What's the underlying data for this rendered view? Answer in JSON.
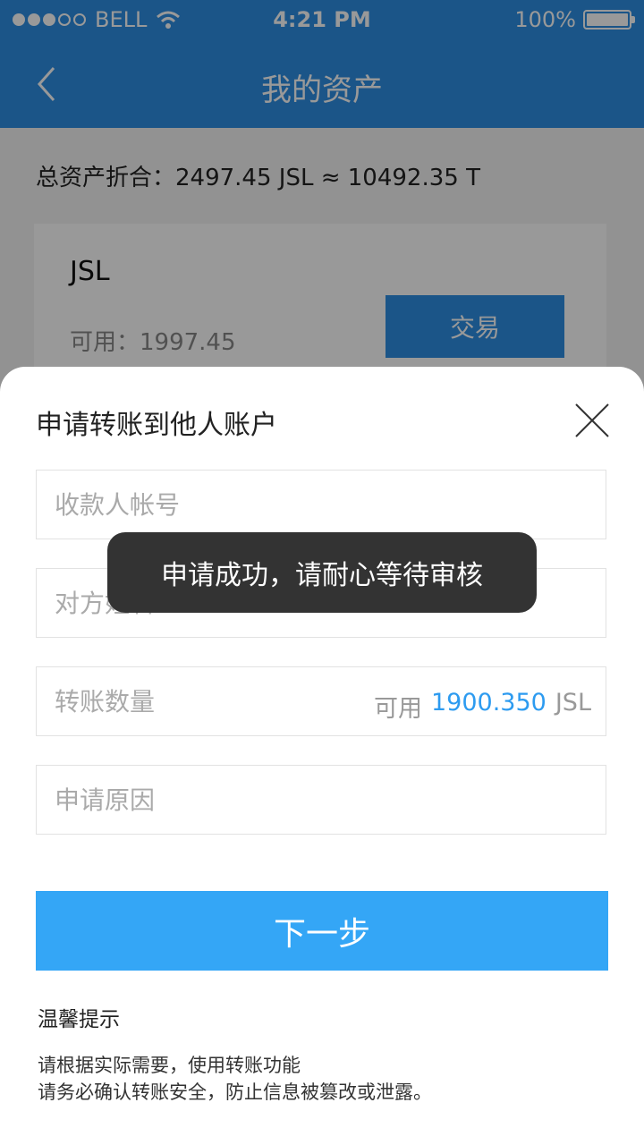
{
  "status_bar": {
    "carrier": "BELL",
    "time": "4:21 PM",
    "battery": "100%"
  },
  "nav": {
    "title": "我的资产",
    "back_icon": "chevron-left-icon"
  },
  "summary": {
    "total_text": "总资产折合：2497.45 JSL ≈ 10492.35 T"
  },
  "asset_card": {
    "coin": "JSL",
    "available": "可用：1997.45",
    "trade_label": "交易"
  },
  "transfer_sheet": {
    "title": "申请转账到他人账户",
    "close_icon": "close-icon",
    "fields": {
      "account_placeholder": "收款人帐号",
      "name_placeholder": "对方姓名",
      "amount_placeholder": "转账数量",
      "amount_available_label": "可用",
      "amount_available_value": "1900.350",
      "amount_unit": "JSL",
      "reason_placeholder": "申请原因"
    },
    "next_label": "下一步",
    "tips_title": "温馨提示",
    "tips_line1": "请根据实际需要，使用转账功能",
    "tips_line2": "请务必确认转账安全，防止信息被篡改或泄露。"
  },
  "toast": {
    "message": "申请成功，请耐心等待审核"
  },
  "colors": {
    "primary": "#2d8ee3",
    "button": "#34a6f6",
    "toast_bg": "#333333"
  }
}
